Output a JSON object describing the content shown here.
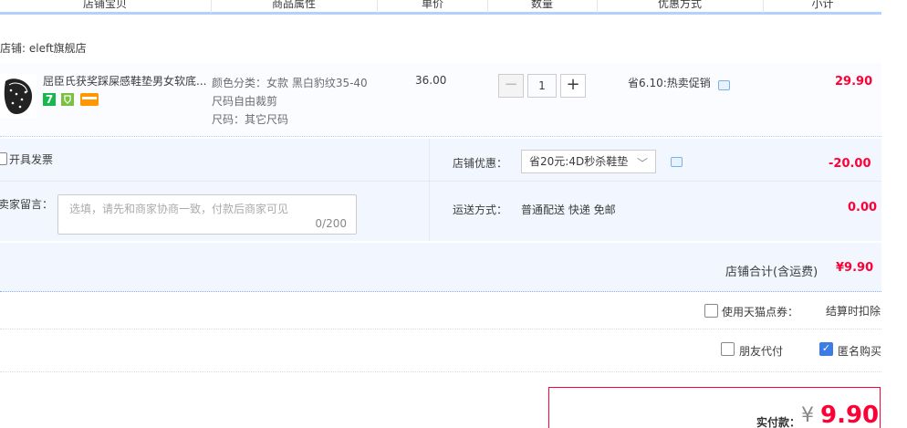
{
  "header": {
    "cols": [
      "店铺宝贝",
      "商品属性",
      "单价",
      "数量",
      "优惠方式",
      "小计"
    ]
  },
  "shop": {
    "label": "店铺: eleft旗舰店"
  },
  "item": {
    "title": "屈臣氏获奖踩屎感鞋垫男女软底...",
    "badge_seven": "7",
    "sku": [
      "颜色分类：女款 黑白豹纹35-40",
      "尺码自由裁剪",
      "尺码：其它尺码"
    ],
    "price": "36.00",
    "quantity": "1",
    "promo": "省6.10:热卖促销",
    "subtotal": "29.90"
  },
  "options": {
    "invoice_label": "开具发票",
    "shop_discount_label": "店铺优惠：",
    "shop_discount_value": "省20元:4D秒杀鞋垫",
    "shop_discount_amount": "-20.00",
    "memo_label": "给卖家留言：",
    "memo_placeholder": "选填，请先和商家协商一致，付款后商家可见",
    "memo_counter": "0/200",
    "shipping_label": "运送方式：",
    "shipping_value": "普通配送 快递 免邮",
    "shipping_fee": "0.00"
  },
  "total": {
    "label": "店铺合计(含运费)",
    "value": "¥9.90"
  },
  "tmall_points": {
    "label": "使用天猫点券：",
    "note": "结算时扣除"
  },
  "friend_pay": {
    "label": "朋友代付",
    "checked": false
  },
  "anonymous": {
    "label": "匿名购买",
    "checked": true
  },
  "pay": {
    "label": "实付款：",
    "symbol": "¥",
    "amount": "9.90"
  },
  "colors": {
    "accent": "#ff0036",
    "header_border": "#b2d1ff",
    "panel_bg": "#f2f7ff"
  }
}
